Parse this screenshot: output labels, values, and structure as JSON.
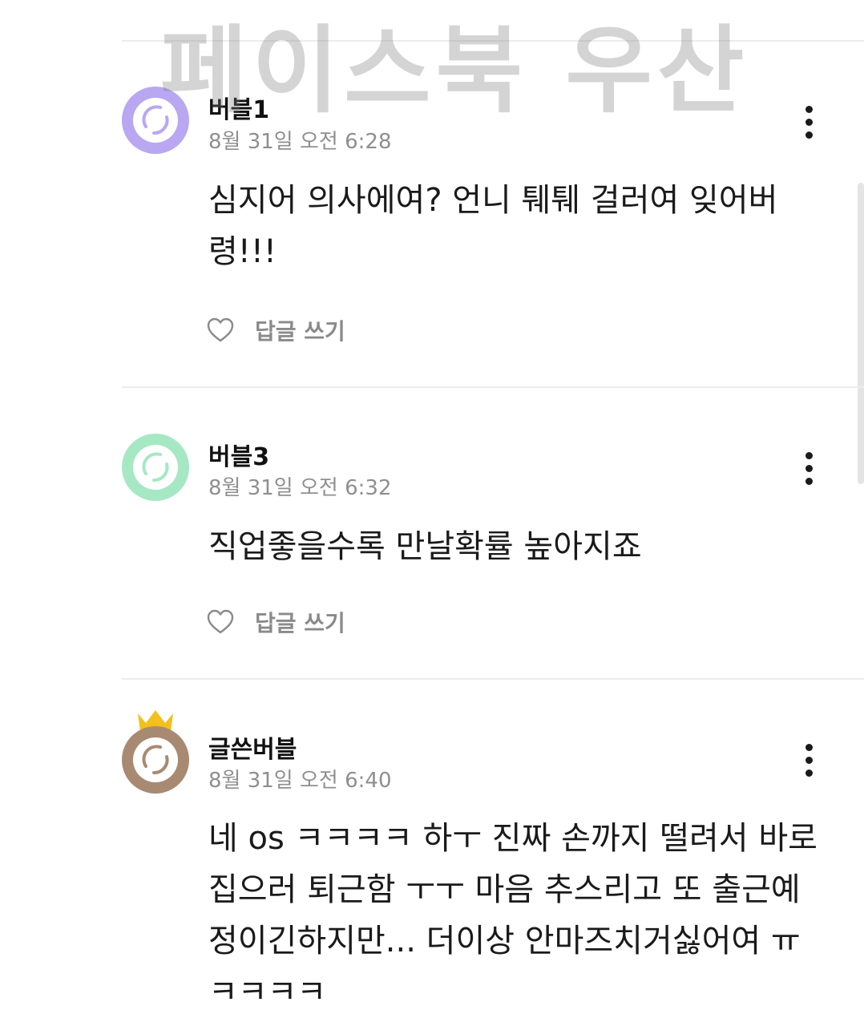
{
  "watermark": "페이스북 우산",
  "colors": {
    "avatar_purple": "#b9a7f2",
    "avatar_green": "#a6e8c4",
    "avatar_brown": "#a88a72",
    "crown": "#f3c01c",
    "text_primary": "#1a1a1a",
    "text_secondary": "#8f8f8f"
  },
  "comments": [
    {
      "author": "버블1",
      "timestamp": "8월 31일 오전 6:28",
      "body": "심지어 의사에여? 언니 퉤퉤 걸러여 잊어버령!!!",
      "reply_label": "답글 쓰기",
      "avatar_icon": "bubble-avatar-purple-icon"
    },
    {
      "author": "버블3",
      "timestamp": "8월 31일 오전 6:32",
      "body": "직업좋을수록 만날확률 높아지죠",
      "reply_label": "답글 쓰기",
      "avatar_icon": "bubble-avatar-green-icon"
    },
    {
      "author": "글쓴버블",
      "timestamp": "8월 31일 오전 6:40",
      "body": "네 os ㅋㅋㅋㅋ 하ㅜ 진짜 손까지 떨려서 바로 집으러 퇴근함 ㅜㅜ 마음 추스리고 또 출근예정이긴하지만... 더이상 안마즈치거싫어여 ㅠㅋㅋㅋㅋ",
      "avatar_icon": "bubble-avatar-brown-icon",
      "badge_icon": "crown-icon"
    }
  ]
}
